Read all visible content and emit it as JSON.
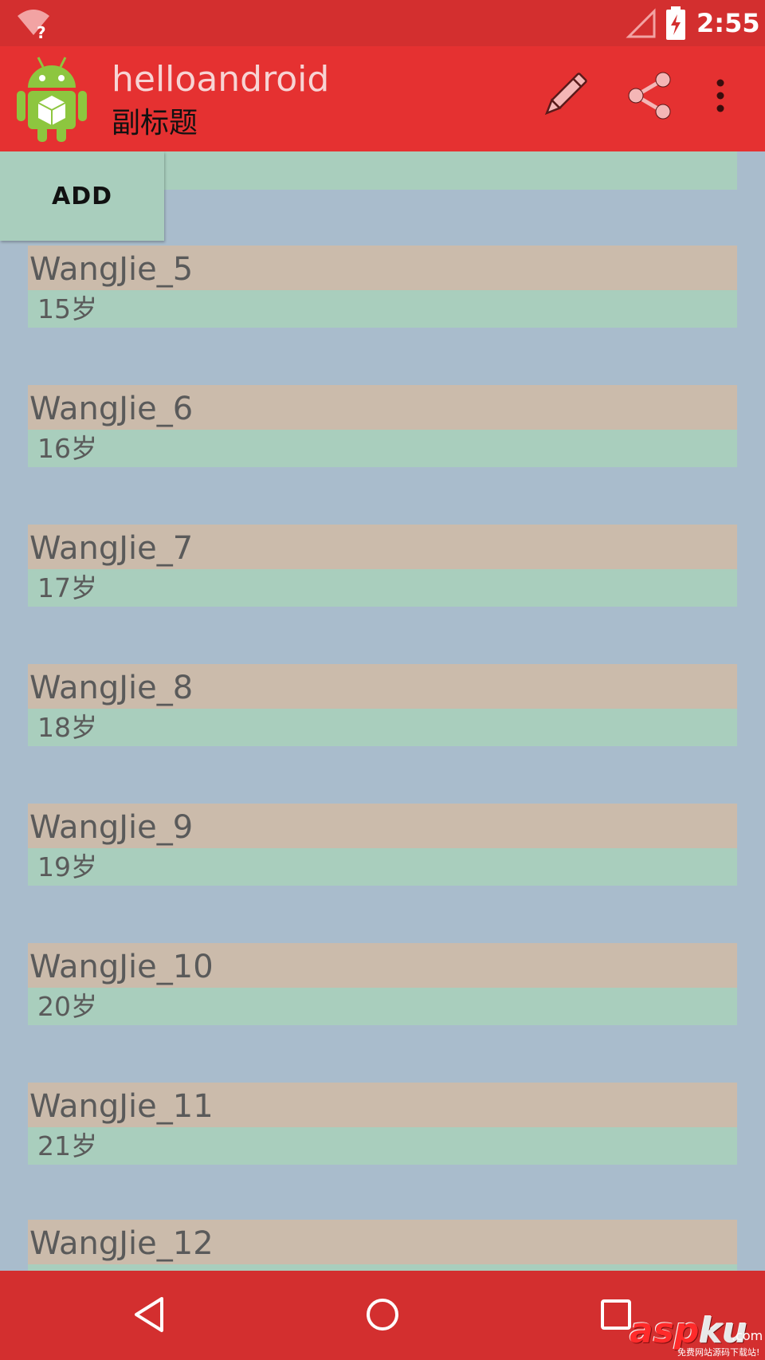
{
  "status_bar": {
    "time": "2:55",
    "wifi_badge": "?",
    "icons": [
      "wifi-question-icon",
      "signal-icon",
      "battery-charging-icon"
    ]
  },
  "app_bar": {
    "title": "helloandroid",
    "subtitle": "副标题",
    "actions": [
      "pencil-icon",
      "share-icon",
      "overflow-menu-icon"
    ]
  },
  "add_button": {
    "label": "ADD"
  },
  "list": {
    "items": [
      {
        "name": "WangJie_5",
        "age": "15岁"
      },
      {
        "name": "WangJie_6",
        "age": "16岁"
      },
      {
        "name": "WangJie_7",
        "age": "17岁"
      },
      {
        "name": "WangJie_8",
        "age": "18岁"
      },
      {
        "name": "WangJie_9",
        "age": "19岁"
      },
      {
        "name": "WangJie_10",
        "age": "20岁"
      },
      {
        "name": "WangJie_11",
        "age": "21岁"
      },
      {
        "name": "WangJie_12",
        "age": ""
      }
    ]
  },
  "nav_bar": {
    "icons": [
      "back-icon",
      "home-icon",
      "recents-icon"
    ]
  },
  "watermark": {
    "brand_a": "asp",
    "brand_b": "ku",
    "domain": ".com",
    "tagline": "免费网站源码下载站!"
  },
  "colors": {
    "status_bar": "#d32f2f",
    "app_bar": "#e53131",
    "background": "#a9bccc",
    "name_row": "#cbbbab",
    "age_row": "#a9cebd",
    "text": "#5a5a5a"
  }
}
